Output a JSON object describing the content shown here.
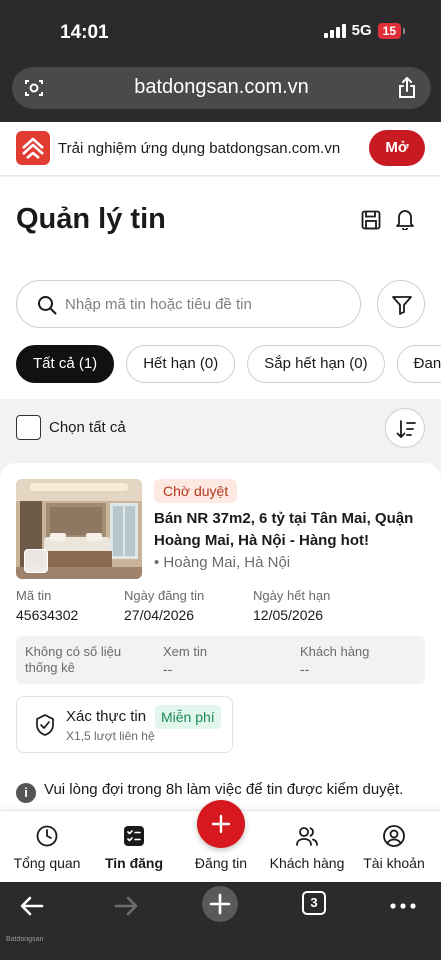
{
  "status_bar": {
    "time": "14:01",
    "network": "5G",
    "battery": "15"
  },
  "browser": {
    "url": "batdongsan.com.vn",
    "tab_count": "3"
  },
  "app_banner": {
    "text": "Trải nghiệm ứng dụng batdongsan.com.vn",
    "open_label": "Mở",
    "logo_icon": "batdongsan-logo-icon",
    "brand_color": "#c81b21"
  },
  "header": {
    "title": "Quản lý tin"
  },
  "search": {
    "placeholder": "Nhập mã tin hoặc tiêu đề tin"
  },
  "filters": [
    {
      "label": "Tất cả (1)",
      "active": true
    },
    {
      "label": "Hết hạn (0)",
      "active": false
    },
    {
      "label": "Sắp hết hạn (0)",
      "active": false
    },
    {
      "label": "Đang hiển thị",
      "active": false
    }
  ],
  "select_all": {
    "label": "Chọn tất cả"
  },
  "listing": {
    "status": "Chờ duyệt",
    "title": "Bán NR 37m2, 6 tỷ tại Tân Mai, Quận Hoàng Mai, Hà Nội - Hàng hot!",
    "location": "• Hoàng Mai, Hà Nội",
    "meta": [
      {
        "label": "Mã tin",
        "value": "45634302"
      },
      {
        "label": "Ngày đăng tin",
        "value": "27/04/2026"
      },
      {
        "label": "Ngày hết hạn",
        "value": "12/05/2026"
      }
    ],
    "stats": [
      {
        "label": "Không có số liệu thống kê",
        "value": ""
      },
      {
        "label": "Xem tin",
        "value": "--"
      },
      {
        "label": "Khách hàng",
        "value": "--"
      }
    ],
    "verify": {
      "title": "Xác thực tin",
      "badge": "Miễn phí",
      "sub": "X1,5 lượt liên hệ"
    }
  },
  "notice": "Vui lòng đợi trong 8h làm việc để tin được kiểm duyệt.",
  "bottom_nav": [
    {
      "label": "Tổng quan",
      "icon": "clock-icon"
    },
    {
      "label": "Tin đăng",
      "icon": "checklist-icon",
      "active": true
    },
    {
      "label": "Đăng tin",
      "icon": "plus-icon"
    },
    {
      "label": "Khách hàng",
      "icon": "users-icon"
    },
    {
      "label": "Tài khoản",
      "icon": "account-icon"
    }
  ],
  "watermark": "Batdongsan"
}
